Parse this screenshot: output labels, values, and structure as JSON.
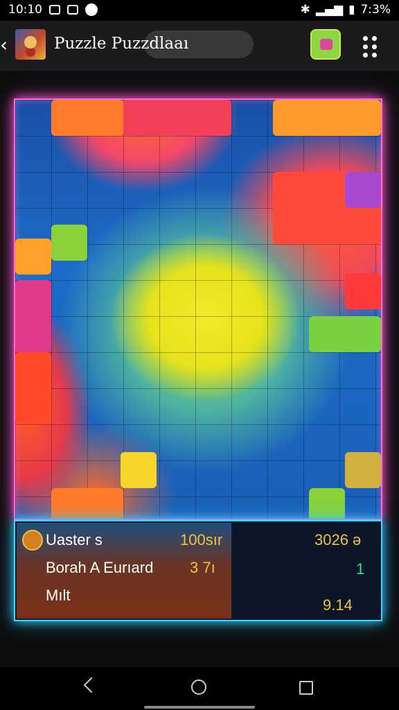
{
  "status_bar": {
    "time": "10:10",
    "battery": "7:3%"
  },
  "app_bar": {
    "title": "Puzzle Puzzdlaaı"
  },
  "info_panel": {
    "left": {
      "row1_label": "Uaster s",
      "row1_value": "100sır",
      "row2_label": "Borah A Eurıard",
      "row2_value": "3 7ı",
      "row3_label": "Mılt"
    },
    "right": {
      "row1_value": "3026 ə",
      "row2_value": "1",
      "row3_value": "9.14"
    }
  },
  "colors": {
    "board_glow": "#ff6ad5",
    "panel_glow": "#3ed4ff",
    "left_value_color": "#f2c23a",
    "right_value_color": "#f2c23a",
    "right_mid_color": "#39e0a0"
  }
}
